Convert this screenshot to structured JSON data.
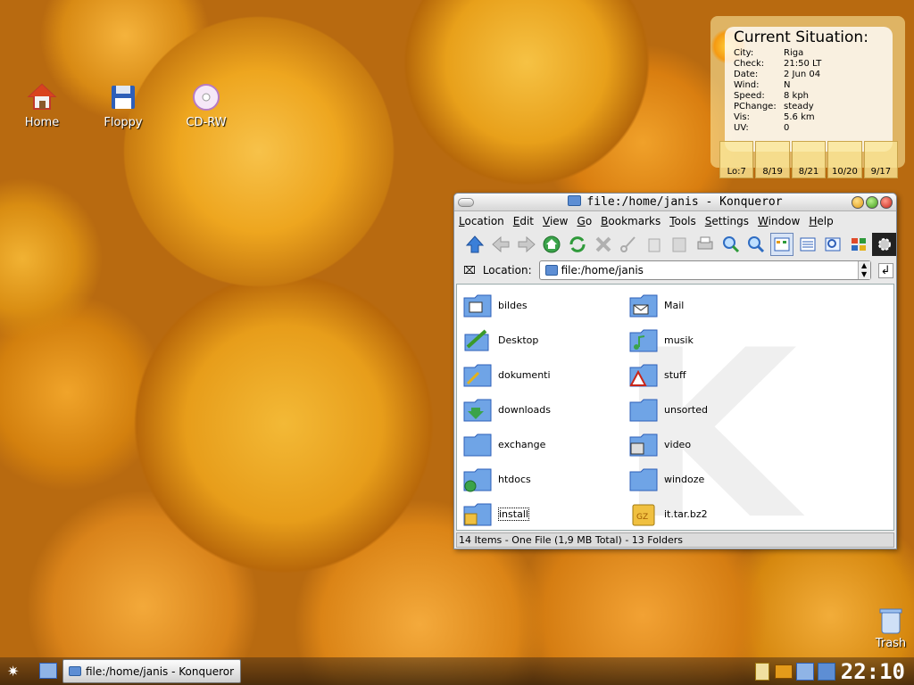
{
  "desktop": {
    "icons": [
      {
        "label": "Home",
        "icon": "home-icon"
      },
      {
        "label": "Floppy",
        "icon": "floppy-icon"
      },
      {
        "label": "CD-RW",
        "icon": "cdrom-icon"
      }
    ],
    "trash_label": "Trash"
  },
  "weather": {
    "title": "Current Situation:",
    "rows": [
      {
        "key": "City:",
        "value": "Riga"
      },
      {
        "key": "Check:",
        "value": "21:50 LT"
      },
      {
        "key": "Date:",
        "value": "2 Jun 04"
      },
      {
        "key": "Wind:",
        "value": "N"
      },
      {
        "key": "Speed:",
        "value": "8 kph"
      },
      {
        "key": "PChange:",
        "value": "steady"
      },
      {
        "key": "Vis:",
        "value": "5.6 km"
      },
      {
        "key": "UV:",
        "value": "0"
      }
    ],
    "days": [
      "Lo:7",
      "8/19",
      "8/21",
      "10/20",
      "9/17"
    ]
  },
  "window": {
    "title": "file:/home/janis - Konqueror",
    "menu": [
      "Location",
      "Edit",
      "View",
      "Go",
      "Bookmarks",
      "Tools",
      "Settings",
      "Window",
      "Help"
    ],
    "location_label": "Location:",
    "location_value": "file:/home/janis",
    "files_left": [
      "bildes",
      "Desktop",
      "dokumenti",
      "downloads",
      "exchange",
      "htdocs",
      "install"
    ],
    "files_right": [
      "Mail",
      "musik",
      "stuff",
      "unsorted",
      "video",
      "windoze",
      "it.tar.bz2"
    ],
    "status": "14 Items - One File (1,9 MB Total) - 13 Folders"
  },
  "taskbar": {
    "task_label": "file:/home/janis - Konqueror",
    "clock": "22:10"
  }
}
